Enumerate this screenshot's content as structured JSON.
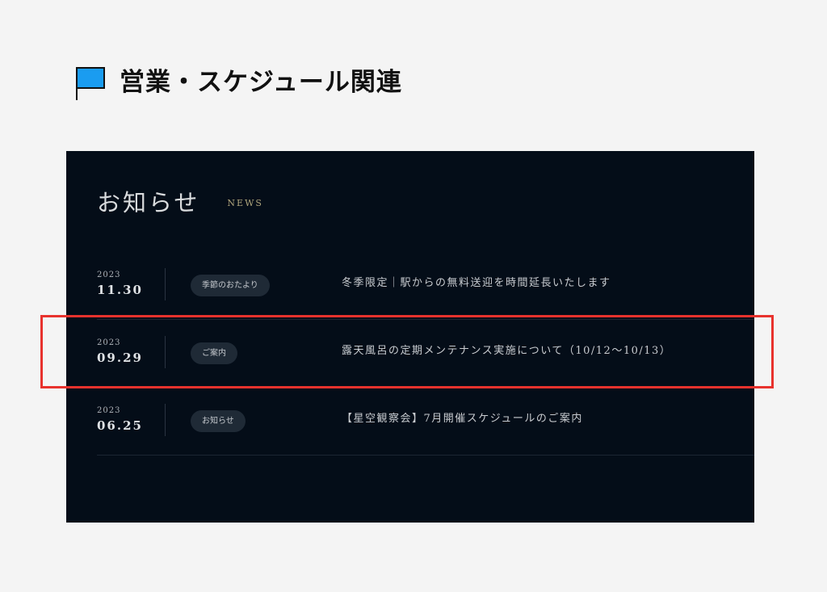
{
  "page": {
    "title": "営業・スケジュール関連",
    "flag_color": "#1a9cf0"
  },
  "news": {
    "title": "お知らせ",
    "subtitle": "NEWS",
    "colors": {
      "panel_background": "#040d18",
      "subtitle": "#b0a67d",
      "tag_background": "#1f2a36"
    },
    "items": [
      {
        "year": "2023",
        "date": "11.30",
        "tag": "季節のおたより",
        "text": "冬季限定｜駅からの無料送迎を時間延長いたします"
      },
      {
        "year": "2023",
        "date": "09.29",
        "tag": "ご案内",
        "text": "露天風呂の定期メンテナンス実施について（10/12〜10/13）"
      },
      {
        "year": "2023",
        "date": "06.25",
        "tag": "お知らせ",
        "text": "【星空観察会】7月開催スケジュールのご案内"
      }
    ]
  },
  "annotation": {
    "highlight_color": "#e8322d",
    "highlighted_item_index": 1
  }
}
